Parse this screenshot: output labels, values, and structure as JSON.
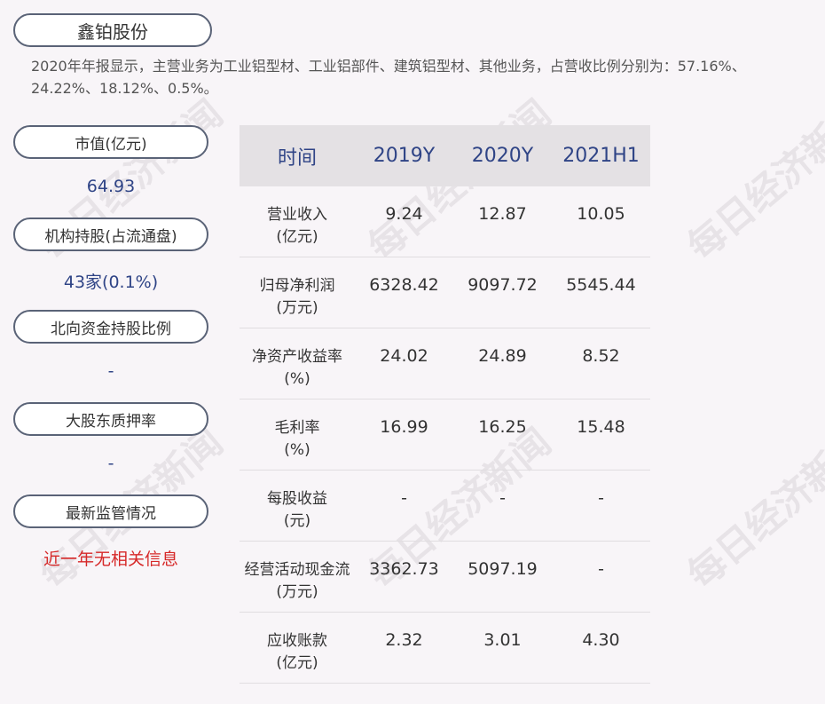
{
  "watermark": "每日经济新闻",
  "company": "鑫铂股份",
  "intro_text": "2020年年报显示，主营业务为工业铝型材、工业铝部件、建筑铝型材、其他业务，占营收比例分别为：57.16%、24.22%、18.12%、0.5%。",
  "sidebar": [
    {
      "label": "市值(亿元)",
      "value": "64.93"
    },
    {
      "label": "机构持股(占流通盘)",
      "value": "43家(0.1%)"
    },
    {
      "label": "北向资金持股比例",
      "value": "-"
    },
    {
      "label": "大股东质押率",
      "value": "-"
    },
    {
      "label": "最新监管情况",
      "value": "近一年无相关信息"
    }
  ],
  "table": {
    "headers": [
      "时间",
      "2019Y",
      "2020Y",
      "2021H1"
    ],
    "rows": [
      {
        "metric": "营业收入",
        "unit": "(亿元)",
        "values": [
          "9.24",
          "12.87",
          "10.05"
        ]
      },
      {
        "metric": "归母净利润",
        "unit": "(万元)",
        "values": [
          "6328.42",
          "9097.72",
          "5545.44"
        ]
      },
      {
        "metric": "净资产收益率",
        "unit": "(%)",
        "values": [
          "24.02",
          "24.89",
          "8.52"
        ]
      },
      {
        "metric": "毛利率",
        "unit": "(%)",
        "values": [
          "16.99",
          "16.25",
          "15.48"
        ]
      },
      {
        "metric": "每股收益",
        "unit": "(元)",
        "values": [
          "-",
          "-",
          "-"
        ]
      },
      {
        "metric": "经营活动现金流",
        "unit": "(万元)",
        "values": [
          "3362.73",
          "5097.19",
          "-"
        ]
      },
      {
        "metric": "应收账款",
        "unit": "(亿元)",
        "values": [
          "2.32",
          "3.01",
          "4.30"
        ]
      }
    ]
  },
  "colors": {
    "header_text": "#2f4486",
    "value_text": "#2f4486",
    "alert_text": "#d62828",
    "pill_border": "#5a6377"
  }
}
